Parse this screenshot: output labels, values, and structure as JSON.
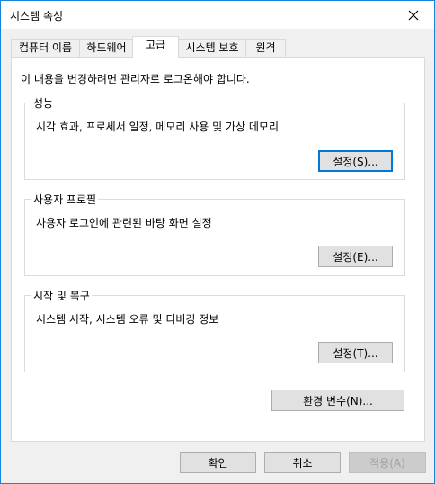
{
  "window": {
    "title": "시스템 속성"
  },
  "tabs": [
    {
      "label": "컴퓨터 이름"
    },
    {
      "label": "하드웨어"
    },
    {
      "label": "고급"
    },
    {
      "label": "시스템 보호"
    },
    {
      "label": "원격"
    }
  ],
  "active_tab": "고급",
  "intro": "이 내용을 변경하려면 관리자로 로그온해야 합니다.",
  "groups": {
    "performance": {
      "title": "성능",
      "desc": "시각 효과, 프로세서 일정, 메모리 사용 및 가상 메모리",
      "button": "설정(S)..."
    },
    "profile": {
      "title": "사용자 프로필",
      "desc": "사용자 로그인에 관련된 바탕 화면 설정",
      "button": "설정(E)..."
    },
    "startup": {
      "title": "시작 및 복구",
      "desc": "시스템 시작, 시스템 오류 및 디버깅 정보",
      "button": "설정(T)..."
    }
  },
  "env_button": "환경 변수(N)...",
  "footer": {
    "ok": "확인",
    "cancel": "취소",
    "apply": "적용(A)"
  },
  "colors": {
    "accent": "#0078d7",
    "border": "#1883d7"
  },
  "icons": {
    "close": "close-icon"
  }
}
